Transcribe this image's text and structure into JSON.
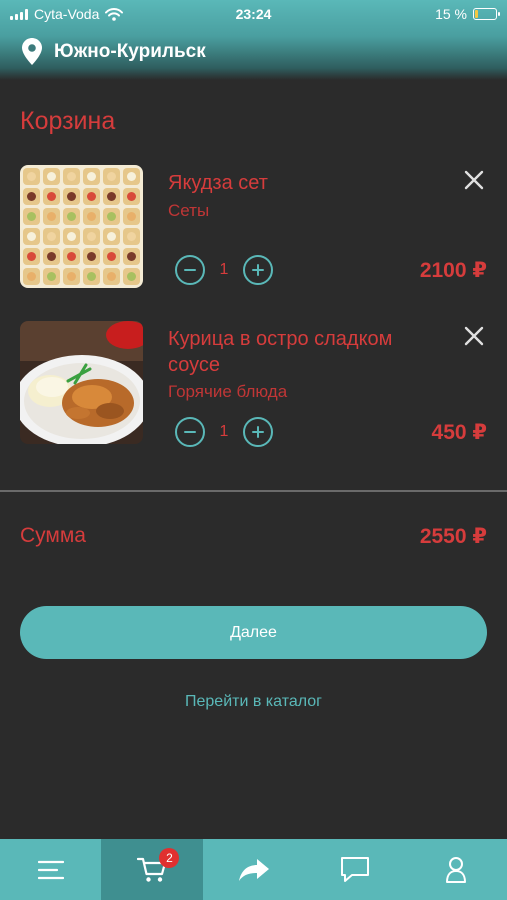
{
  "status": {
    "carrier": "Cyta-Voda",
    "time": "23:24",
    "battery": "15 %"
  },
  "location": "Южно-Курильск",
  "title": "Корзина",
  "items": [
    {
      "name": "Якудза сет",
      "category": "Сеты",
      "qty": "1",
      "price": "2100 ₽"
    },
    {
      "name": "Курица в остро сладком соусе",
      "category": "Горячие блюда",
      "qty": "1",
      "price": "450 ₽"
    }
  ],
  "summary": {
    "label": "Сумма",
    "value": "2550 ₽"
  },
  "next_button": "Далее",
  "catalog_link": "Перейти в каталог",
  "tabbar": {
    "cart_badge": "2",
    "icons": [
      "menu-icon",
      "cart-icon",
      "share-icon",
      "chat-icon",
      "profile-icon"
    ]
  },
  "colors": {
    "accent": "#5ab8b8",
    "accent_dark": "#3f8f90",
    "text_red": "#d63c3c",
    "background": "#2b2b2b",
    "badge": "#e03030"
  }
}
